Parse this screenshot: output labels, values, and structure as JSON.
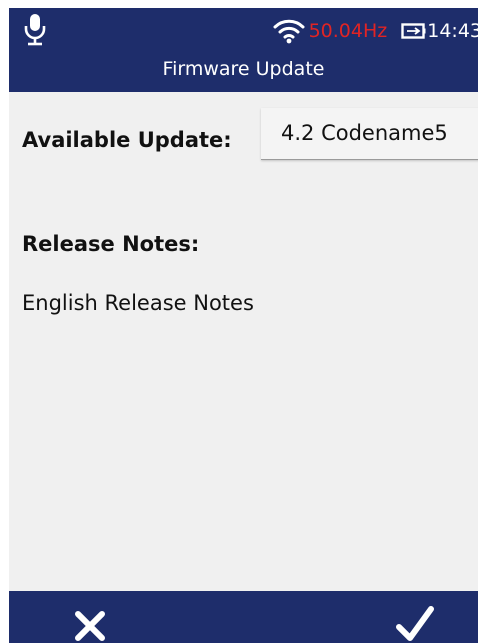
{
  "status_bar": {
    "mic_icon": "microphone-icon",
    "wifi_icon": "wifi-icon",
    "frequency": "50.04Hz",
    "frequency_color": "#e02424",
    "battery_icon": "battery-charging-icon",
    "time": "14:43"
  },
  "header": {
    "title": "Firmware Update",
    "background": "#1e2d6b"
  },
  "main": {
    "available_update_label": "Available Update:",
    "available_update_value": "4.2 Codename5",
    "release_notes_label": "Release Notes:",
    "release_notes_text": "English Release Notes",
    "background": "#f0f0f0"
  },
  "footer": {
    "cancel_icon": "close-icon",
    "confirm_icon": "checkmark-icon",
    "background": "#1e2d6b"
  }
}
